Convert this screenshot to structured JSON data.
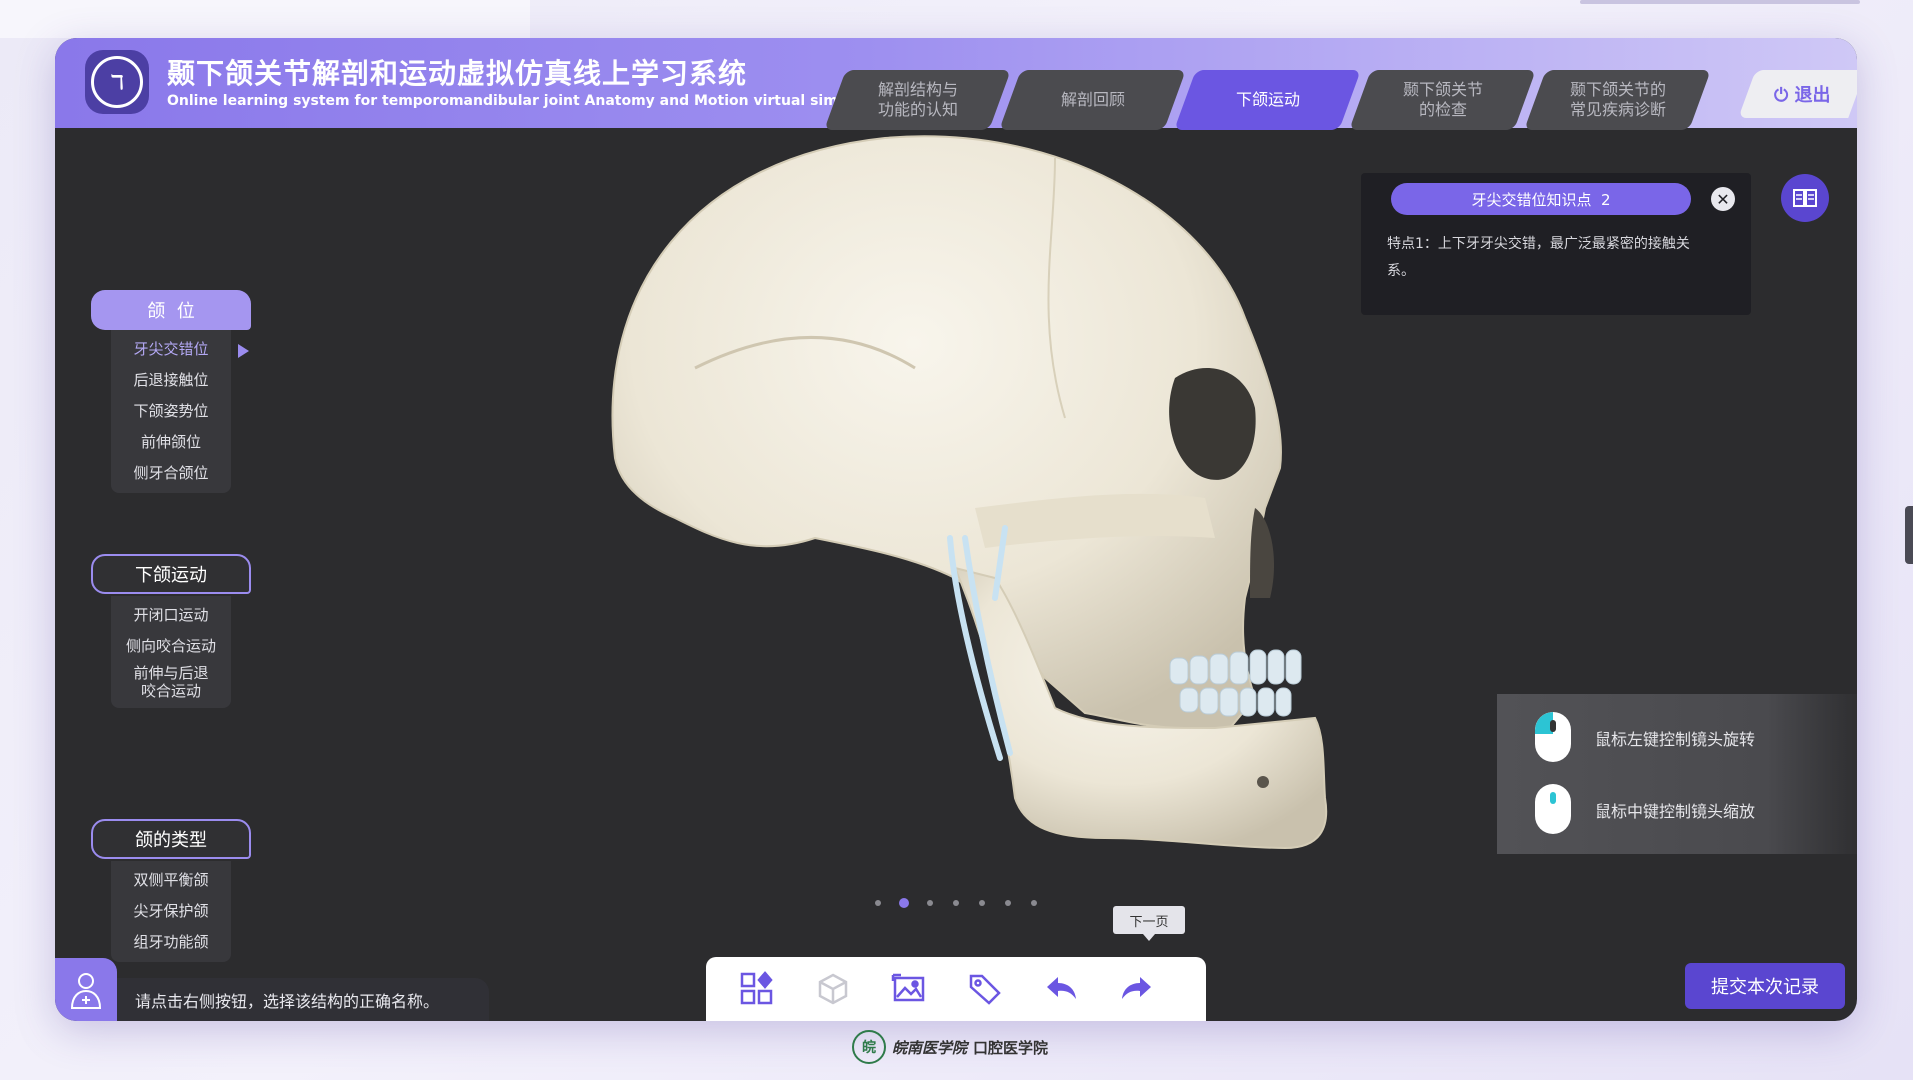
{
  "app": {
    "title_cn": "颞下颌关节解剖和运动虚拟仿真线上学习系统",
    "title_en": "Online learning system for temporomandibular joint Anatomy and Motion virtual simulation",
    "logo_icon": "jaw-head-icon"
  },
  "nav": {
    "tabs": [
      {
        "label": "解剖结构与\n功能的认知",
        "active": false
      },
      {
        "label": "解剖回顾",
        "active": false
      },
      {
        "label": "下颌运动",
        "active": true
      },
      {
        "label": "颞下颌关节\n的检查",
        "active": false
      },
      {
        "label": "颞下颌关节的\n常见疾病诊断",
        "active": false
      }
    ],
    "exit_label": "退出",
    "exit_icon": "power-icon"
  },
  "sidebar": {
    "sections": [
      {
        "title": "颌  位",
        "items": [
          "牙尖交错位",
          "后退接触位",
          "下颌姿势位",
          "前伸颌位",
          "侧牙合颌位"
        ],
        "active_item": 0
      },
      {
        "title": "下颌运动",
        "items": [
          "开闭口运动",
          "侧向咬合运动",
          "前伸与后退\n咬合运动"
        ]
      },
      {
        "title": "颌的类型",
        "items": [
          "双侧平衡颌",
          "尖牙保护颌",
          "组牙功能颌"
        ]
      }
    ]
  },
  "info": {
    "heading": "牙尖交错位知识点  2",
    "body": "特点1：上下牙牙尖交错，最广泛最紧密的接触关系。",
    "close_icon": "close-icon",
    "book_icon": "book-icon"
  },
  "hints": {
    "rotate": "鼠标左键控制镜头旋转",
    "zoom": "鼠标中键控制镜头缩放"
  },
  "pager": {
    "count": 7,
    "active": 1
  },
  "tooltip": "下一页",
  "toolbar": {
    "icons": [
      "grid-icon",
      "cube-view-icon",
      "image-icon",
      "tag-icon",
      "undo-icon",
      "redo-icon"
    ]
  },
  "prompt": "请点击右侧按钮，选择该结构的正确名称。",
  "submit_label": "提交本次记录",
  "footer": {
    "uni": "皖南医学院",
    "school": "口腔医学院"
  },
  "colors": {
    "accent": "#7a66e8",
    "dark": "#2c2c2e",
    "header": "#8a78ea"
  }
}
